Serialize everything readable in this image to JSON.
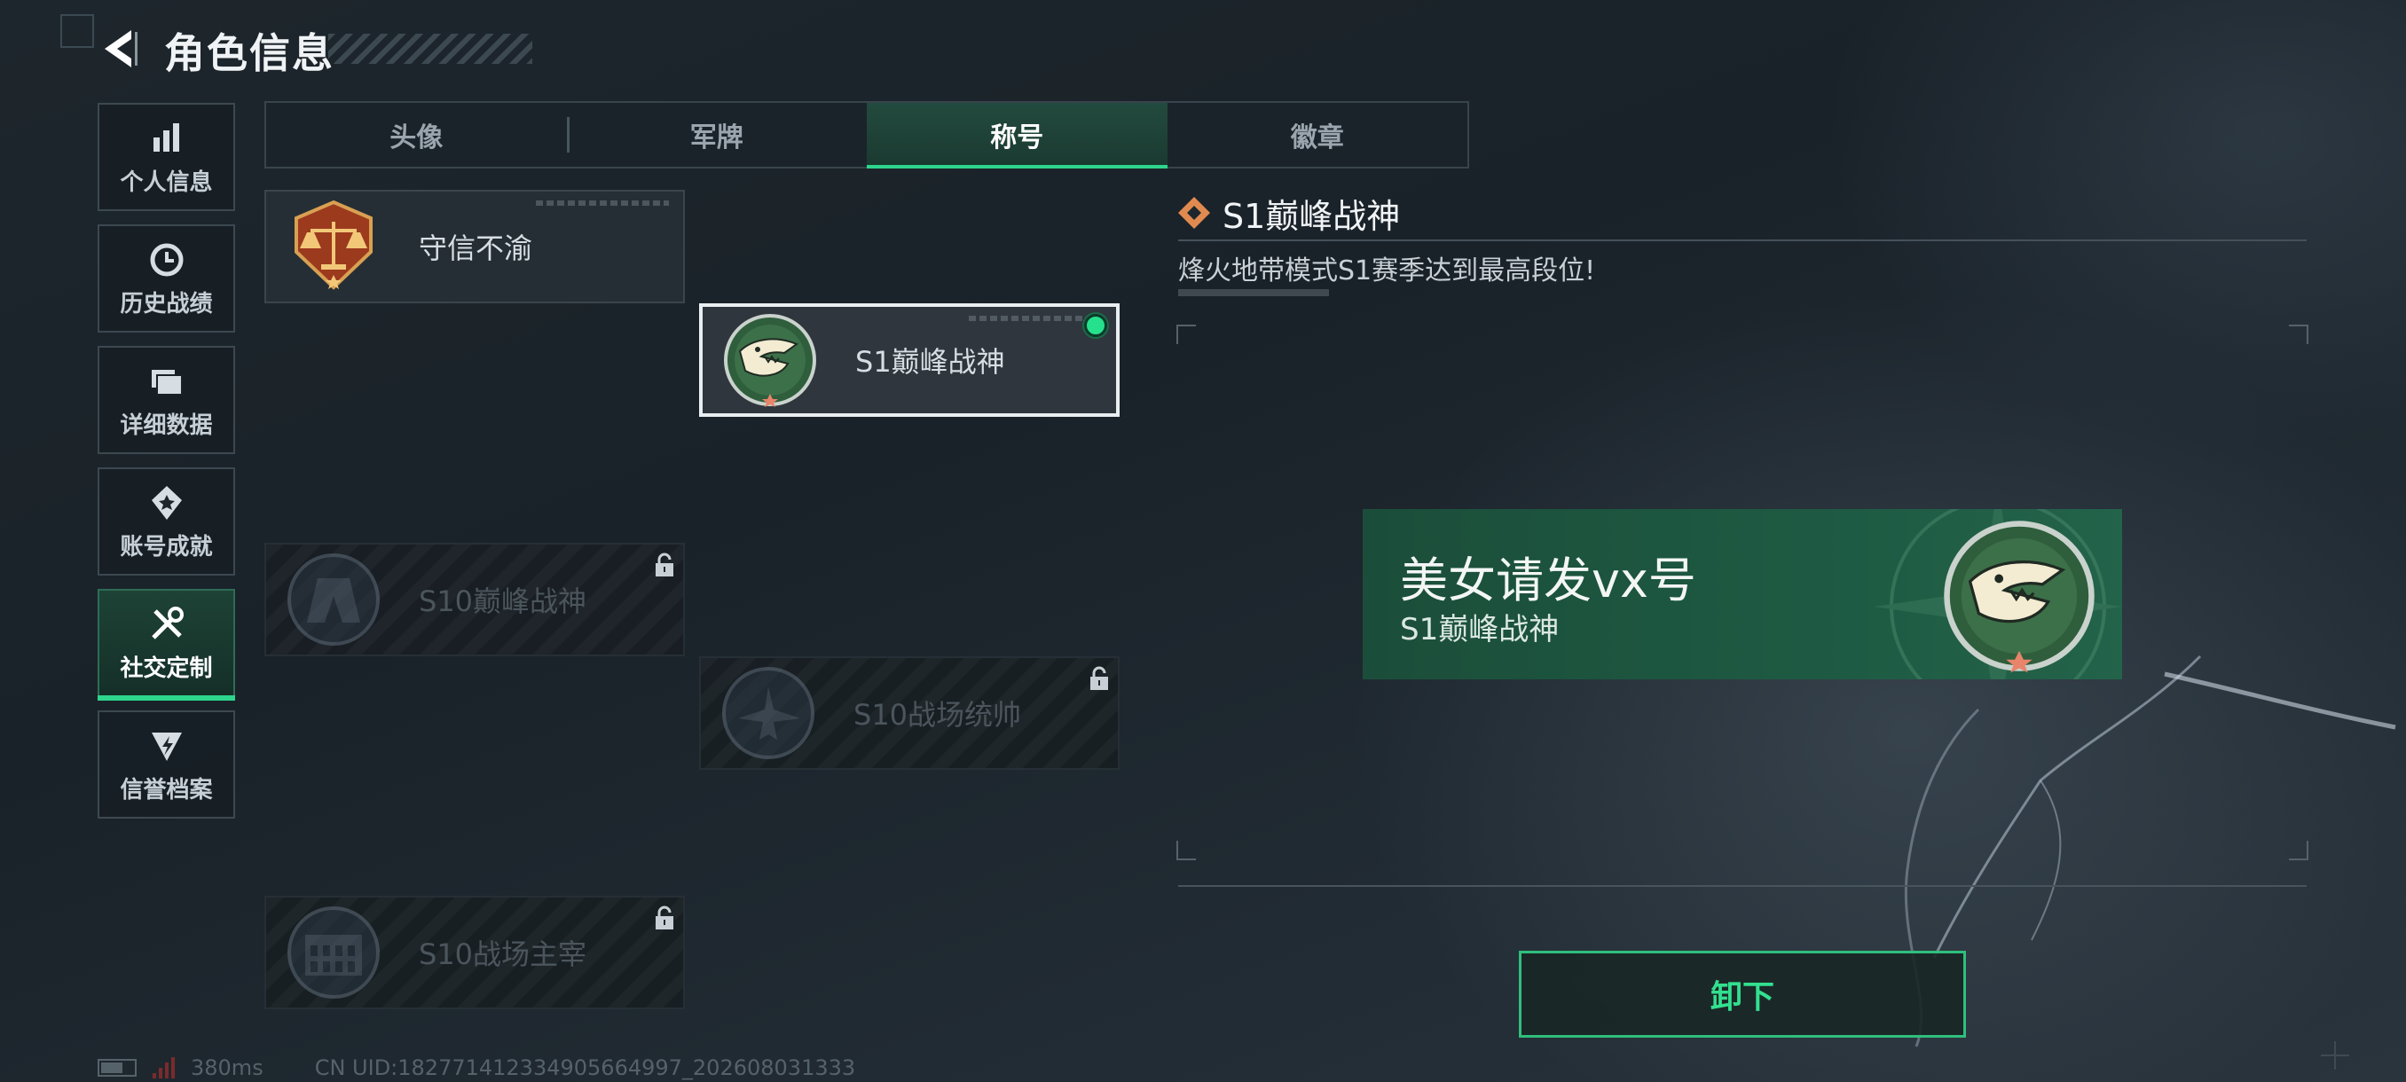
{
  "header": {
    "title": "角色信息"
  },
  "nav": [
    {
      "label": "个人信息",
      "icon": "bar-chart-icon",
      "active": false
    },
    {
      "label": "历史战绩",
      "icon": "clock-icon",
      "active": false
    },
    {
      "label": "详细数据",
      "icon": "folder-icon",
      "active": false
    },
    {
      "label": "账号成就",
      "icon": "medal-icon",
      "active": false
    },
    {
      "label": "社交定制",
      "icon": "tools-icon",
      "active": true
    },
    {
      "label": "信誉档案",
      "icon": "reputation-icon",
      "active": false
    }
  ],
  "tabs": [
    {
      "label": "头像",
      "active": false
    },
    {
      "label": "军牌",
      "active": false
    },
    {
      "label": "称号",
      "active": true
    },
    {
      "label": "徽章",
      "active": false
    }
  ],
  "titles": [
    {
      "label": "守信不渝",
      "emblem": "scales-emblem-icon",
      "locked": false,
      "selected": false
    },
    {
      "label": "S1巅峰战神",
      "emblem": "crocodile-emblem-icon",
      "locked": false,
      "selected": true,
      "equipped": true
    },
    {
      "label": "S10巅峰战神",
      "emblem": "building-emblem-icon",
      "locked": true,
      "selected": false
    },
    {
      "label": "S10战场统帅",
      "emblem": "aircraft-emblem-icon",
      "locked": true,
      "selected": false
    },
    {
      "label": "S10战场主宰",
      "emblem": "colosseum-emblem-icon",
      "locked": true,
      "selected": false
    }
  ],
  "detail": {
    "title": "S1巅峰战神",
    "description": "烽火地带模式S1赛季达到最高段位!"
  },
  "preview": {
    "player_name": "美女请发vx号",
    "title": "S1巅峰战神"
  },
  "actions": {
    "unequip_label": "卸下"
  },
  "status": {
    "ping": "380ms",
    "uid": "CN UID:18277141233490566499​7_202608031333"
  },
  "colors": {
    "accent": "#2ed58c",
    "banner": "#1e5a43",
    "equipped": "#25e08c"
  }
}
